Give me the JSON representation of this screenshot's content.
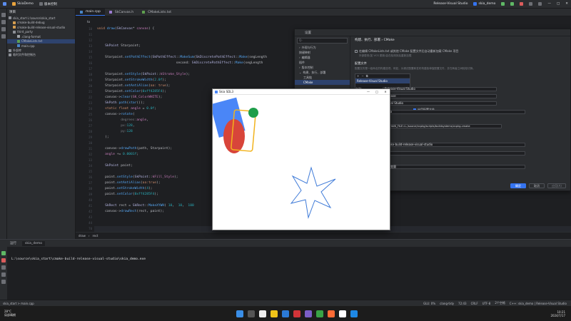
{
  "titlebar": {
    "project": "SkiaDemo",
    "vcs": "版本控制",
    "run_config": "Release-Visual Studio",
    "target": "skia_demo"
  },
  "project_panel": {
    "header": "项目",
    "items": [
      {
        "label": "skia_start  L:\\source\\skia_start",
        "kind": "folder"
      },
      {
        "label": "cmake-build-debug",
        "kind": "folder-orange"
      },
      {
        "label": "cmake-build-release-visual-studio",
        "kind": "folder-orange"
      },
      {
        "label": "third_party",
        "kind": "folder"
      },
      {
        "label": ".clang-format",
        "kind": "file"
      },
      {
        "label": "CMakeLists.txt",
        "kind": "cmake"
      },
      {
        "label": "main.cpp",
        "kind": "cpp"
      },
      {
        "label": "外部库",
        "kind": "lib"
      },
      {
        "label": "临时文件和控制台",
        "kind": "scratch"
      }
    ]
  },
  "editor": {
    "tabs": [
      {
        "label": "main.cpp",
        "active": true
      },
      {
        "label": "SkCanvas.h",
        "active": false
      },
      {
        "label": "CMakeLists.txt",
        "active": false
      }
    ],
    "first_line": "to",
    "line_numbers": [
      "10",
      "11",
      "12",
      "13",
      "14",
      "15",
      "16",
      "17",
      "18",
      "19",
      "20",
      "21",
      "22",
      "23",
      "24",
      "25",
      "26",
      "27",
      "28",
      "29",
      "30",
      "31",
      "32",
      "33",
      "34",
      "35",
      "36",
      "37",
      "38",
      "39",
      "40",
      "41",
      "42",
      "43",
      "44",
      "70",
      "71",
      "72"
    ],
    "breadcrumb": [
      "draw",
      "rect"
    ]
  },
  "settings": {
    "title": "设置",
    "search_placeholder": "Q-",
    "nav": [
      {
        "label": "外观与行为",
        "sel": false
      },
      {
        "label": "按键映射",
        "sel": false
      },
      {
        "label": "编辑器",
        "sel": false
      },
      {
        "label": "插件",
        "sel": false
      },
      {
        "label": "版本控制",
        "sel": false
      },
      {
        "label": "构建、执行、部署",
        "sel": false
      },
      {
        "label": "工具链",
        "sel": false
      },
      {
        "label": "CMake",
        "sel": true
      },
      {
        "label": "Release-Visual Studio",
        "sel": false
      }
    ],
    "crumbs": "构建、执行、部署  ›  CMake",
    "reload_label": "在编辑 CMakeLists.txt 或其他 CMake 配置文件后自动重新加载 CMake 项目",
    "reload_hint": "外部更改(如 VCS 更新)会在检测到后重新加载",
    "profiles_title": "配置文件",
    "profiles_hint": "配置文件是一组命名的构建选项。例如，为调试配置和发布构建各单独配置文件，并在两者之间轻松切换。",
    "profile_enable": "启用配置文件",
    "fields": [
      {
        "label": "名称:",
        "value": "Release-Visual Studio"
      },
      {
        "label": "构建类型:",
        "value": "Release"
      },
      {
        "label": "工具链:",
        "value": "Visual Studio"
      },
      {
        "label": "生成器:",
        "value": "Ninja"
      },
      {
        "label": "CMake 选项:",
        "value": "G Ninja -DCMAKE_TOOLCHAIN_FILE=L:/source/vcpkg/scripts/buildsystems/vcpkg.cmake"
      }
    ],
    "env_title": "缓存变量",
    "build_dir_label": "构建目录:",
    "build_dir_value": "cmake-build-release-visual-studio",
    "build_opts_label": "构建选项:",
    "build_opts_value": "-j 6",
    "env_label": "环境:",
    "env_value": "环境变量",
    "buttons": {
      "ok": "确定",
      "cancel": "取消",
      "apply": "应用(A)"
    }
  },
  "sdl_window": {
    "title": "Skia SDL3",
    "colors": {
      "blue": "#4a86f7",
      "red": "#d8453a",
      "green": "#1f9e4a",
      "yellow": "#f2b31d",
      "star": "#3f7bd8"
    }
  },
  "run_panel": {
    "tab_label": "运行",
    "config": "skia_demo",
    "output": "L:\\source\\skia_start\\cmake-build-release-visual-studio\\skia_demo.exe"
  },
  "statusbar": {
    "left": "skia_start  >  main.cpp",
    "right": [
      "GLU: 0%",
      "clang-tidy",
      "72:43",
      "CRLF",
      "UTF-8",
      "2个空格",
      "C++: skia_demo | Release-Visual Studio"
    ]
  },
  "taskbar": {
    "weather": "28°C",
    "weather_desc": "局部晴朗",
    "time": "10:21",
    "date": "2024/7/17"
  }
}
